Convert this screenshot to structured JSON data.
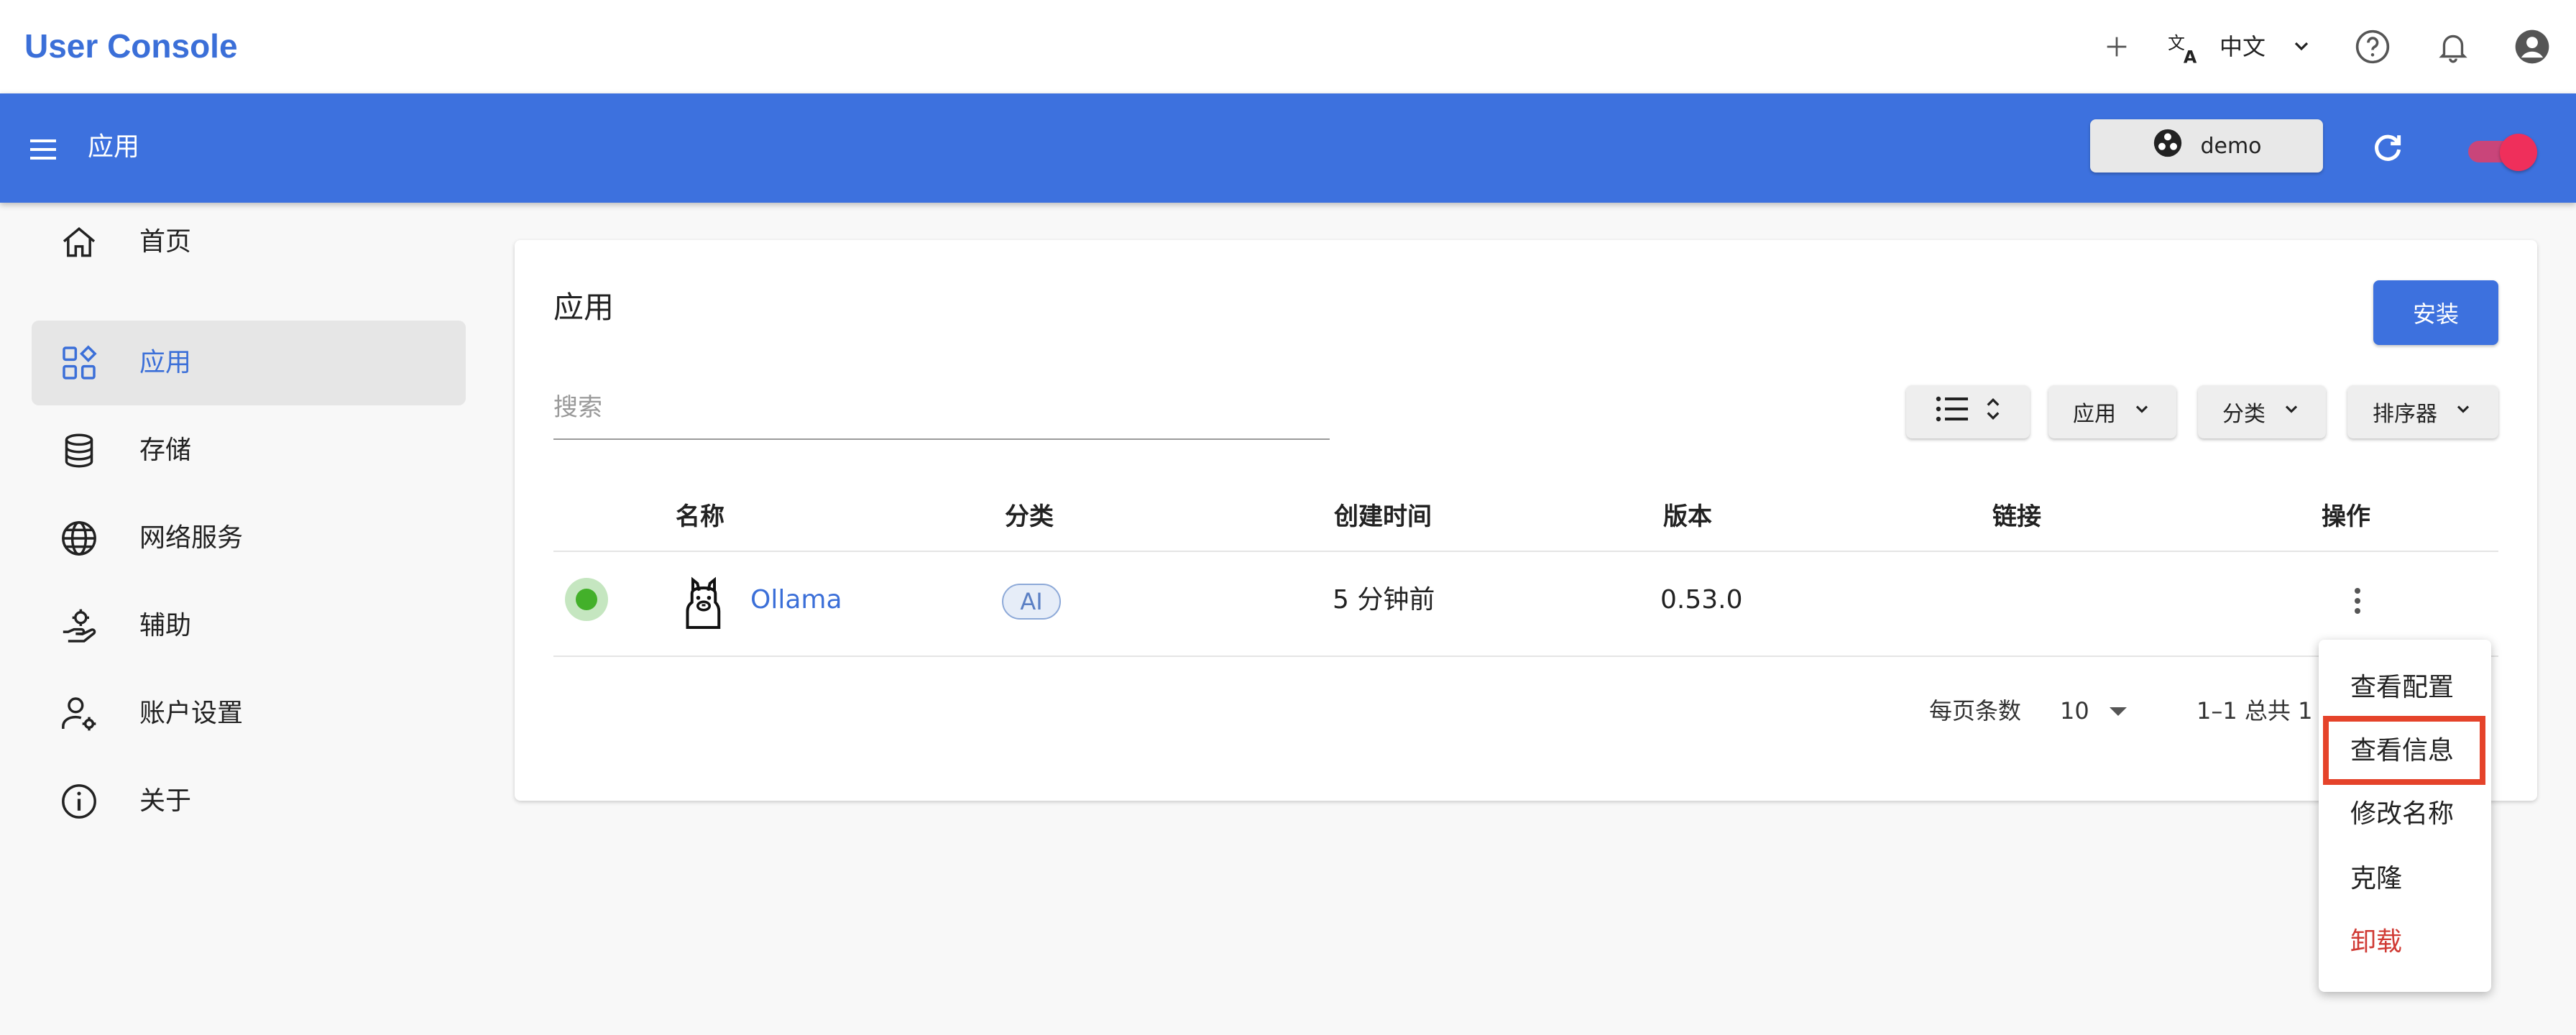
{
  "header": {
    "brand": "User Console",
    "language": "中文",
    "icons": [
      "plus-icon",
      "translate-icon",
      "chevron-down-icon",
      "help-icon",
      "bell-icon",
      "account-icon"
    ]
  },
  "appbar": {
    "title": "应用",
    "namespace": "demo",
    "icons": [
      "menu-icon",
      "namespace-icon",
      "refresh-icon"
    ]
  },
  "sidebar": {
    "items": [
      {
        "label": "首页",
        "icon": "home-icon"
      },
      {
        "label": "应用",
        "icon": "apps-icon",
        "active": true
      },
      {
        "label": "存储",
        "icon": "database-icon"
      },
      {
        "label": "网络服务",
        "icon": "globe-icon"
      },
      {
        "label": "辅助",
        "icon": "hand-gear-icon"
      },
      {
        "label": "账户设置",
        "icon": "user-gear-icon"
      },
      {
        "label": "关于",
        "icon": "info-icon"
      }
    ]
  },
  "main": {
    "title": "应用",
    "install_label": "安装",
    "search_placeholder": "搜索",
    "filters": {
      "app": "应用",
      "category": "分类",
      "sorter": "排序器"
    },
    "table": {
      "columns": [
        "名称",
        "分类",
        "创建时间",
        "版本",
        "链接",
        "操作"
      ],
      "rows": [
        {
          "name": "Ollama",
          "category": "AI",
          "created": "5 分钟前",
          "version": "0.53.0",
          "link": "",
          "status_color": "#43b02a"
        }
      ]
    },
    "pagination": {
      "per_page_label": "每页条数",
      "per_page": "10",
      "range": "1–1 总共 1"
    }
  },
  "context_menu": {
    "items": [
      {
        "label": "查看配置"
      },
      {
        "label": "查看信息",
        "highlighted": true
      },
      {
        "label": "修改名称"
      },
      {
        "label": "克隆"
      },
      {
        "label": "卸载",
        "danger": true
      }
    ]
  },
  "colors": {
    "primary": "#3d71de",
    "danger": "#d03a34",
    "highlight": "#e5432a"
  }
}
